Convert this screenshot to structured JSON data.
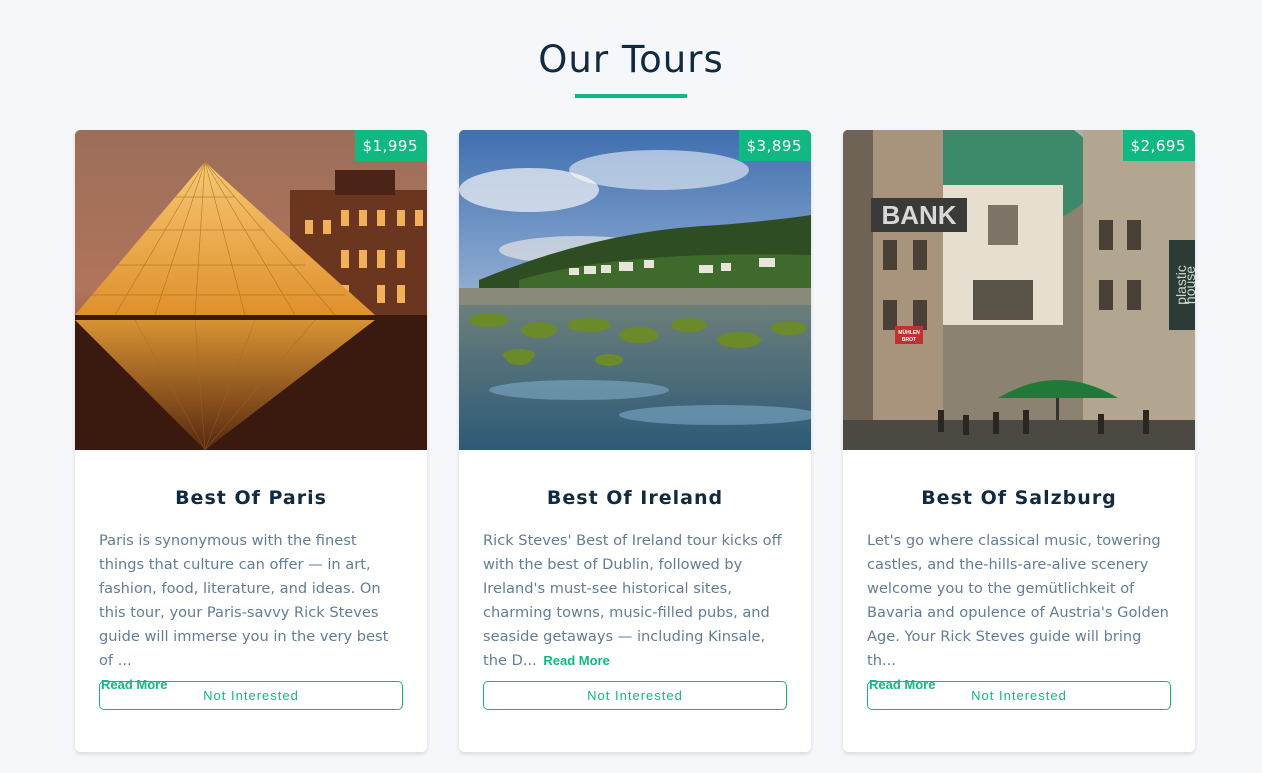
{
  "header": {
    "title": "Our Tours"
  },
  "colors": {
    "accent": "#10b981",
    "heading": "#102a42",
    "text": "#617d98",
    "background": "#f5f7fa"
  },
  "tours": [
    {
      "name": "Best Of Paris",
      "price": "$1,995",
      "image": "louvre-pyramid-photo",
      "description": "Paris is synonymous with the finest things that culture can offer — in art, fashion, food, literature, and ideas. On this tour, your Paris-savvy Rick Steves guide will immerse you in the very best of ...",
      "read_more": "Read More",
      "button": "Not Interested"
    },
    {
      "name": "Best Of Ireland",
      "price": "$3,895",
      "image": "irish-coast-photo",
      "description": "Rick Steves' Best of Ireland tour kicks off with the best of Dublin, followed by Ireland's must-see historical sites, charming towns, music-filled pubs, and seaside getaways — including Kinsale, the D...",
      "read_more": "Read More",
      "button": "Not Interested"
    },
    {
      "name": "Best Of Salzburg",
      "price": "$2,695",
      "image": "vienna-street-photo",
      "image_text": [
        "BANK",
        "plastic",
        "house",
        "MÜHLEN",
        "BROT"
      ],
      "description": "Let's go where classical music, towering castles, and the-hills-are-alive scenery welcome you to the gemütlichkeit of Bavaria and opulence of Austria's Golden Age. Your Rick Steves guide will bring th...",
      "read_more": "Read More",
      "button": "Not Interested"
    }
  ]
}
